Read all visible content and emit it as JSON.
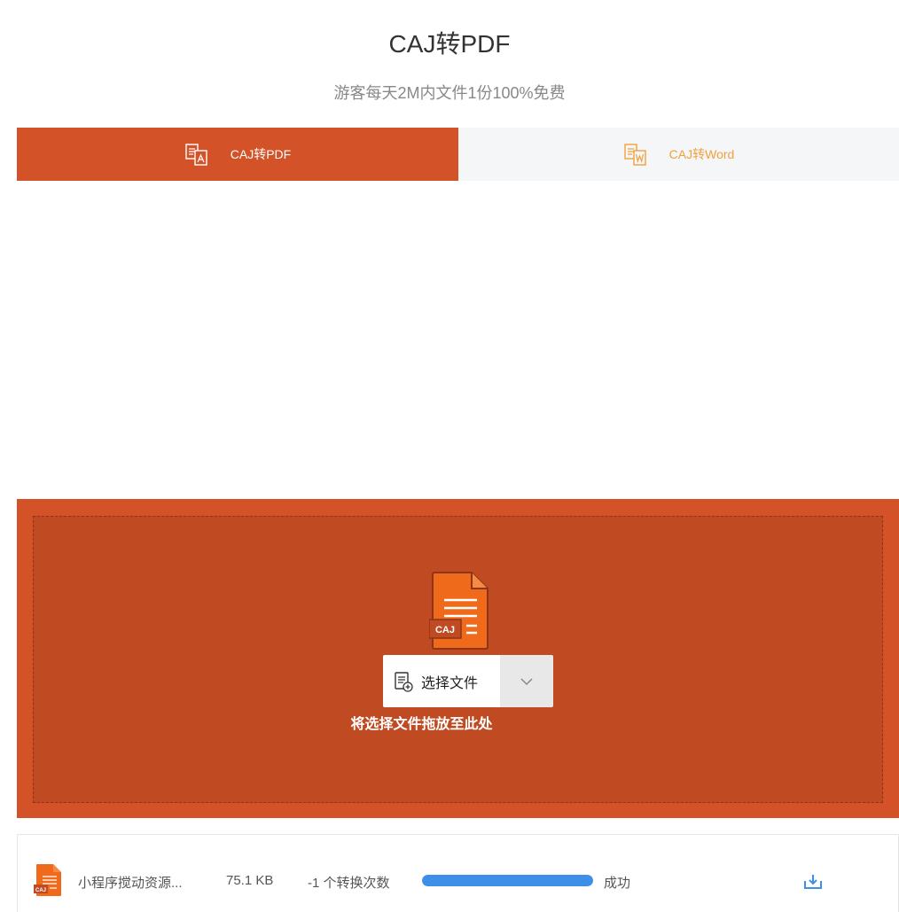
{
  "header": {
    "title": "CAJ转PDF",
    "subtitle": "游客每天2M内文件1份100%免费"
  },
  "tabs": [
    {
      "label": "CAJ转PDF",
      "icon": "caj-pdf-icon",
      "active": true
    },
    {
      "label": "CAJ转Word",
      "icon": "caj-word-icon",
      "active": false
    }
  ],
  "dropzone": {
    "file_icon_label": "CAJ",
    "select_button_label": "选择文件",
    "hint": "将选择文件拖放至此处"
  },
  "files": [
    {
      "name": "小程序搅动资源...",
      "size": "75.1 KB",
      "count": "-1 个转换次数",
      "progress": 1.0,
      "status": "成功"
    }
  ],
  "colors": {
    "accent": "#d45227",
    "dropzone_inner": "#c04b22",
    "inactive_tab_text": "#f0a13c",
    "progress": "#3d8fe8"
  }
}
